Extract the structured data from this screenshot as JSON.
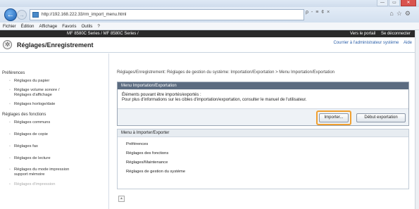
{
  "browser": {
    "url": "http://192.168.222.33/rm_import_menu.html",
    "address_tools": "ρ - ≡ ¢ ×",
    "icons": [
      "home-icon",
      "star-icon",
      "gear-icon"
    ],
    "window_controls": [
      "—",
      "▭",
      "✕"
    ],
    "menu": [
      "Fichier",
      "Édition",
      "Affichage",
      "Favoris",
      "Outils",
      "?"
    ]
  },
  "device": {
    "name": "MF 8580C Series / MF 8580C Series /",
    "portal_link": "Vers le portail",
    "logout_link": "Se déconnecter"
  },
  "header": {
    "title": "Réglages/Enregistrement",
    "admin_link": "Courrier à l'administrateur système",
    "help_link": "Aide"
  },
  "sidebar": {
    "section1": "Préférences",
    "items1": [
      {
        "label": "Réglages du papier"
      },
      {
        "label": "Réglage volume sonore /",
        "label2": "Réglages d'affichage"
      },
      {
        "label": "Réglages horloge/date"
      }
    ],
    "section2": "Réglages des fonctions",
    "items2": [
      {
        "label": "Réglages communs"
      },
      {
        "label": "Réglages de copie"
      },
      {
        "label": "Réglages fax"
      },
      {
        "label": "Réglages de lecture"
      },
      {
        "label": "Réglages du mode impression",
        "label2": "support mémoire"
      },
      {
        "label": "Réglages d'impression"
      }
    ]
  },
  "main": {
    "breadcrumb": "Réglages/Enregistrement: Réglages de gestion du système: Importation/Exportation > Menu Importation/Exportation",
    "panel_title": "Menu Importation/Exportation",
    "panel_line1": "Éléments pouvant être importés/exportés :",
    "panel_line2": "Pour plus d'informations sur les cibles d'importation/exportation, consulter le manuel de l'utilisateur.",
    "import_button": "Importer...",
    "export_button": "Début exportation",
    "list_title": "Menu à Importer/Exporter",
    "list_items": [
      "Préférences",
      "Réglages des fonctions",
      "Réglages/Maintenance",
      "Réglages de gestion du système"
    ]
  }
}
